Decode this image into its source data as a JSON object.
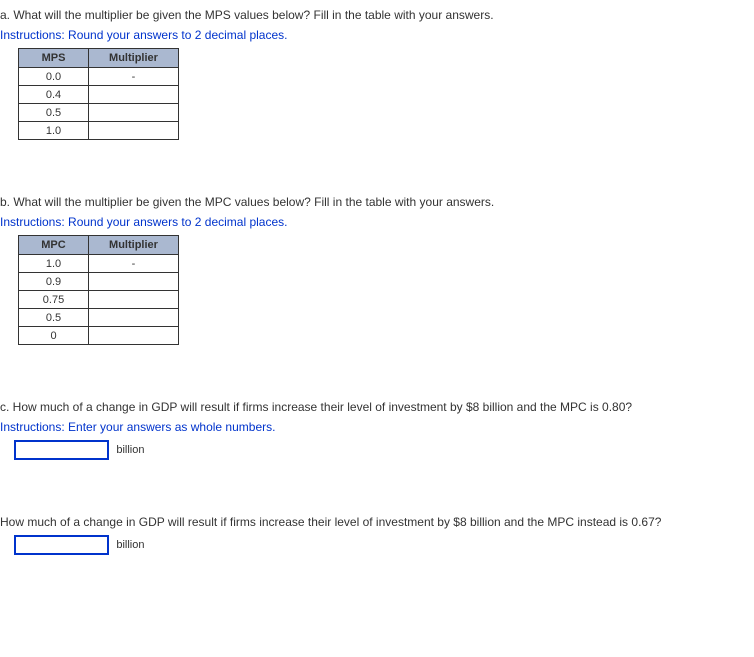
{
  "partA": {
    "question": "a. What will the multiplier be given the MPS values below? Fill in the table with your answers.",
    "instructions": "Instructions: Round your answers to 2 decimal places.",
    "col1": "MPS",
    "col2": "Multiplier",
    "rows": [
      {
        "val": "0.0",
        "mult": "-"
      },
      {
        "val": "0.4",
        "mult": ""
      },
      {
        "val": "0.5",
        "mult": ""
      },
      {
        "val": "1.0",
        "mult": ""
      }
    ]
  },
  "partB": {
    "question": "b. What will the multiplier be given the MPC values below? Fill in the table with your answers.",
    "instructions": "Instructions: Round your answers to 2 decimal places.",
    "col1": "MPC",
    "col2": "Multiplier",
    "rows": [
      {
        "val": "1.0",
        "mult": "-"
      },
      {
        "val": "0.9",
        "mult": ""
      },
      {
        "val": "0.75",
        "mult": ""
      },
      {
        "val": "0.5",
        "mult": ""
      },
      {
        "val": "0",
        "mult": ""
      }
    ]
  },
  "partC": {
    "question": "c. How much of a change in GDP will result if firms increase their level of investment by $8 billion and the MPC is 0.80?",
    "instructions": "Instructions: Enter your answers as whole numbers.",
    "unit": "billion"
  },
  "partD": {
    "question": "How much of a change in GDP will result if firms increase their level of investment by $8 billion and the MPC instead is 0.67?",
    "unit": "billion"
  }
}
